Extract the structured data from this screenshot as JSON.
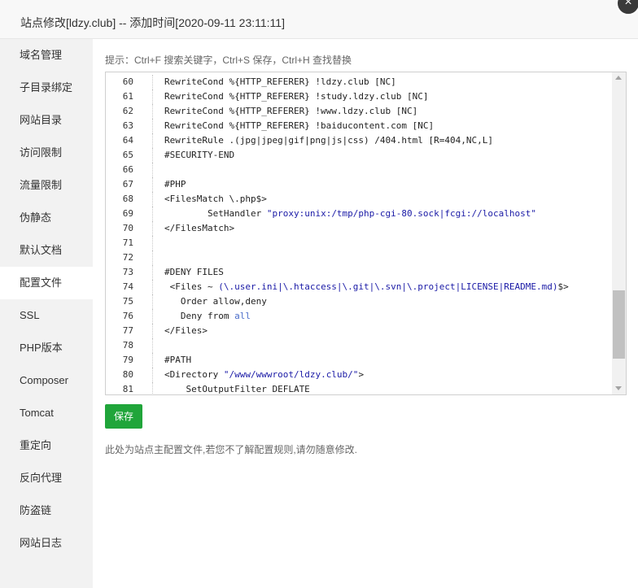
{
  "dialog": {
    "title": "站点修改[ldzy.club] -- 添加时间[2020-09-11 23:11:11]",
    "close_label": "×"
  },
  "sidebar": {
    "items": [
      {
        "label": "域名管理"
      },
      {
        "label": "子目录绑定"
      },
      {
        "label": "网站目录"
      },
      {
        "label": "访问限制"
      },
      {
        "label": "流量限制"
      },
      {
        "label": "伪静态"
      },
      {
        "label": "默认文档"
      },
      {
        "label": "配置文件",
        "active": true
      },
      {
        "label": "SSL"
      },
      {
        "label": "PHP版本"
      },
      {
        "label": "Composer"
      },
      {
        "label": "Tomcat"
      },
      {
        "label": "重定向"
      },
      {
        "label": "反向代理"
      },
      {
        "label": "防盗链"
      },
      {
        "label": "网站日志"
      }
    ]
  },
  "hint": "提示：Ctrl+F 搜索关键字，Ctrl+S 保存，Ctrl+H 查找替换",
  "editor": {
    "lines": [
      {
        "n": "60",
        "text": "RewriteCond %{HTTP_REFERER} !ldzy.club [NC]"
      },
      {
        "n": "61",
        "text": "RewriteCond %{HTTP_REFERER} !study.ldzy.club [NC]"
      },
      {
        "n": "62",
        "text": "RewriteCond %{HTTP_REFERER} !www.ldzy.club [NC]"
      },
      {
        "n": "63",
        "text": "RewriteCond %{HTTP_REFERER} !baiducontent.com [NC]"
      },
      {
        "n": "64",
        "text": "RewriteRule .(jpg|jpeg|gif|png|js|css) /404.html [R=404,NC,L]"
      },
      {
        "n": "65",
        "text": "#SECURITY-END"
      },
      {
        "n": "66",
        "text": ""
      },
      {
        "n": "67",
        "text": "#PHP"
      },
      {
        "n": "68",
        "text": "<FilesMatch \\.php$>"
      },
      {
        "n": "69",
        "pre": "        SetHandler ",
        "str": "\"proxy:unix:/tmp/php-cgi-80.sock|fcgi://localhost\"",
        "post": ""
      },
      {
        "n": "70",
        "text": "</FilesMatch>"
      },
      {
        "n": "71",
        "text": ""
      },
      {
        "n": "72",
        "text": ""
      },
      {
        "n": "73",
        "text": "#DENY FILES"
      },
      {
        "n": "74",
        "pre": " <Files ~ ",
        "str": "(\\.user.ini|\\.htaccess|\\.git|\\.svn|\\.project|LICENSE|README.md)",
        "post": "$>"
      },
      {
        "n": "75",
        "text": "   Order allow,deny"
      },
      {
        "n": "76",
        "pre": "   Deny from ",
        "kw": "all",
        "post": ""
      },
      {
        "n": "77",
        "text": "</Files>"
      },
      {
        "n": "78",
        "text": ""
      },
      {
        "n": "79",
        "text": "#PATH"
      },
      {
        "n": "80",
        "pre": "<Directory ",
        "str": "\"/www/wwwroot/ldzy.club/\"",
        "post": ">"
      },
      {
        "n": "81",
        "text": "    SetOutputFilter DEFLATE"
      }
    ]
  },
  "save_label": "保存",
  "note": "此处为站点主配置文件,若您不了解配置规则,请勿随意修改."
}
